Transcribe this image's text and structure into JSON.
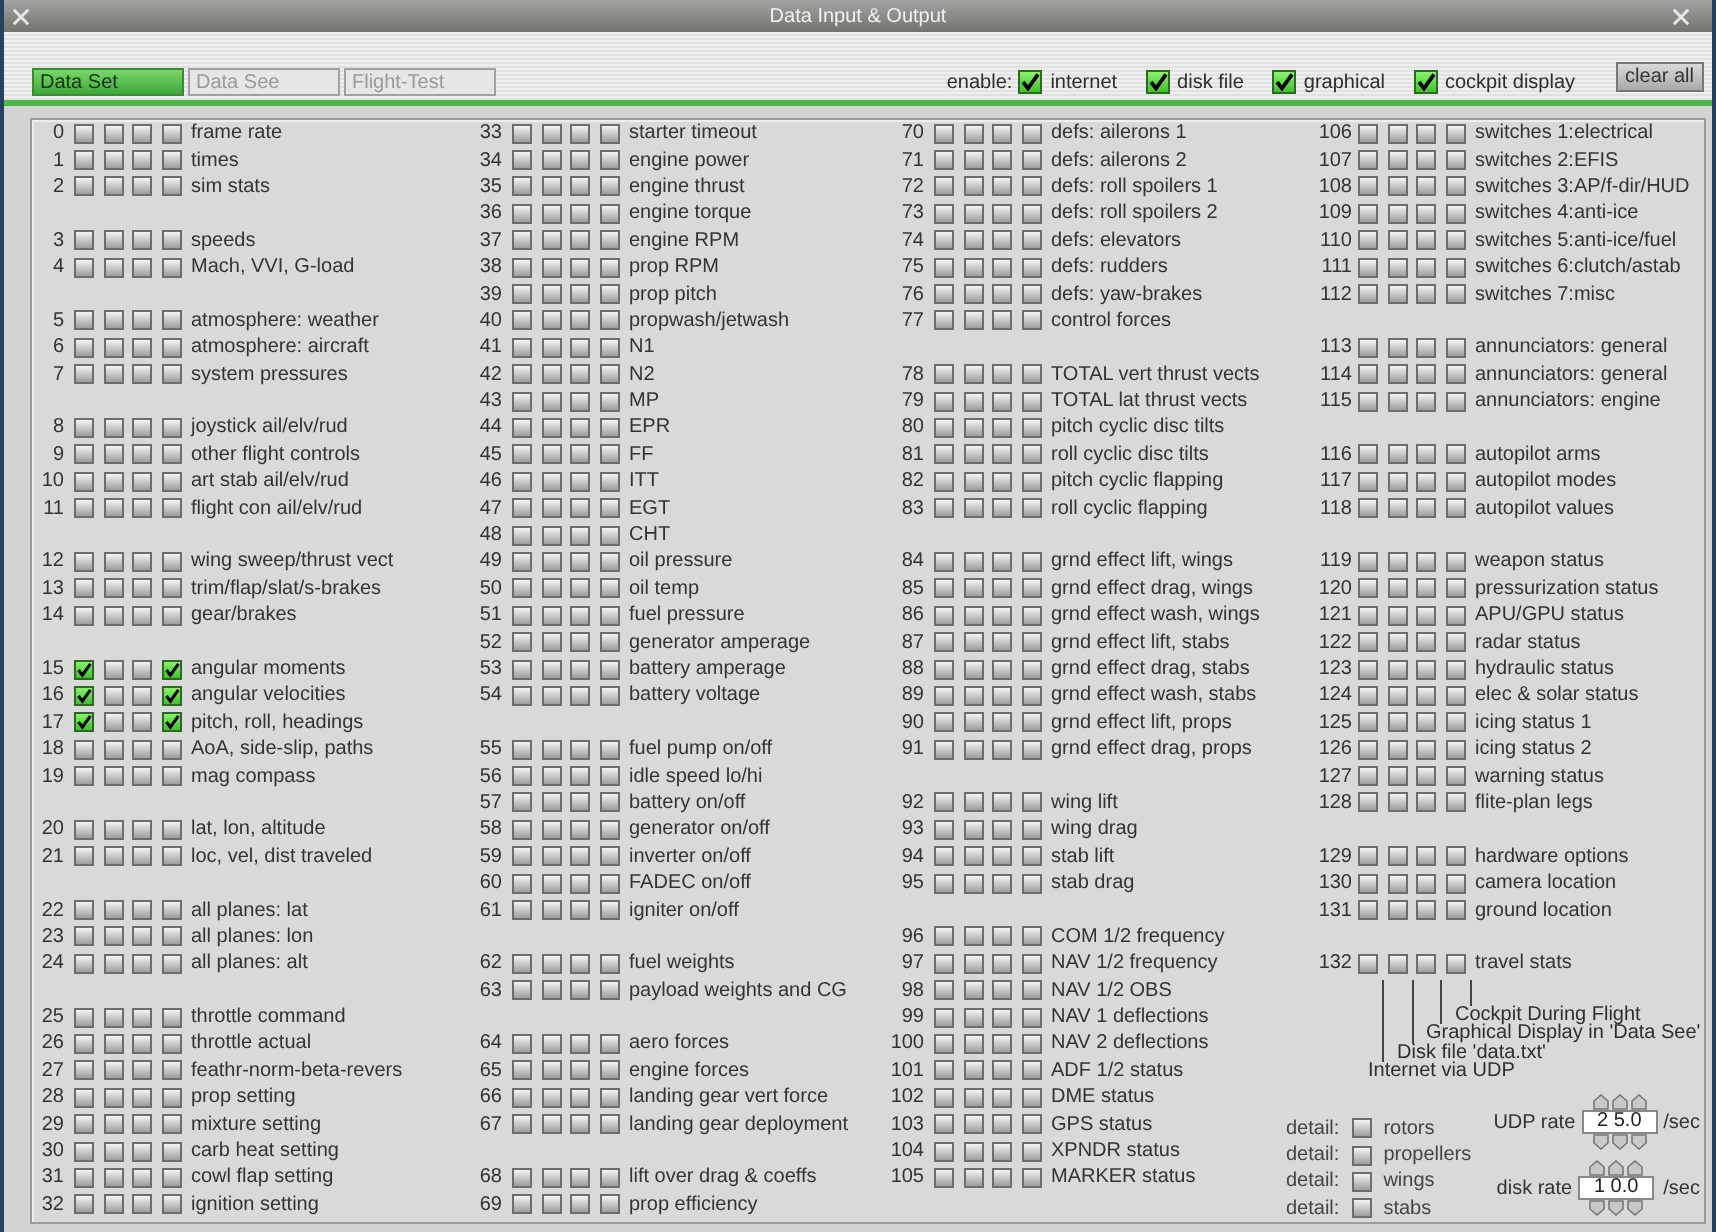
{
  "window": {
    "title": "Data Input & Output"
  },
  "tabs": [
    {
      "label": "Data Set",
      "selected": true
    },
    {
      "label": "Data See",
      "selected": false
    },
    {
      "label": "Flight-Test",
      "selected": false
    }
  ],
  "enable": {
    "label": "enable:",
    "options": [
      {
        "label": "internet",
        "checked": true
      },
      {
        "label": "disk file",
        "checked": true
      },
      {
        "label": "graphical",
        "checked": true
      },
      {
        "label": "cockpit display",
        "checked": true
      }
    ]
  },
  "clear_button": "clear all",
  "columns": [
    {
      "groups": [
        {
          "rows": [
            {
              "number": "0",
              "label": "frame rate",
              "checked": [
                false,
                false,
                false,
                false
              ]
            },
            {
              "number": "1",
              "label": "times",
              "checked": [
                false,
                false,
                false,
                false
              ]
            },
            {
              "number": "2",
              "label": "sim stats",
              "checked": [
                false,
                false,
                false,
                false
              ]
            }
          ]
        },
        {
          "rows": [
            {
              "number": "3",
              "label": "speeds",
              "checked": [
                false,
                false,
                false,
                false
              ]
            },
            {
              "number": "4",
              "label": "Mach, VVI, G-load",
              "checked": [
                false,
                false,
                false,
                false
              ]
            }
          ]
        },
        {
          "rows": [
            {
              "number": "5",
              "label": "atmosphere: weather",
              "checked": [
                false,
                false,
                false,
                false
              ]
            },
            {
              "number": "6",
              "label": "atmosphere: aircraft",
              "checked": [
                false,
                false,
                false,
                false
              ]
            },
            {
              "number": "7",
              "label": "system pressures",
              "checked": [
                false,
                false,
                false,
                false
              ]
            }
          ]
        },
        {
          "rows": [
            {
              "number": "8",
              "label": "joystick ail/elv/rud",
              "checked": [
                false,
                false,
                false,
                false
              ]
            },
            {
              "number": "9",
              "label": "other flight controls",
              "checked": [
                false,
                false,
                false,
                false
              ]
            },
            {
              "number": "10",
              "label": "art stab ail/elv/rud",
              "checked": [
                false,
                false,
                false,
                false
              ]
            },
            {
              "number": "11",
              "label": "flight con ail/elv/rud",
              "checked": [
                false,
                false,
                false,
                false
              ]
            }
          ]
        },
        {
          "rows": [
            {
              "number": "12",
              "label": "wing sweep/thrust vect",
              "checked": [
                false,
                false,
                false,
                false
              ]
            },
            {
              "number": "13",
              "label": "trim/flap/slat/s-brakes",
              "checked": [
                false,
                false,
                false,
                false
              ]
            },
            {
              "number": "14",
              "label": "gear/brakes",
              "checked": [
                false,
                false,
                false,
                false
              ]
            }
          ]
        },
        {
          "rows": [
            {
              "number": "15",
              "label": "angular moments",
              "checked": [
                true,
                false,
                false,
                true
              ]
            },
            {
              "number": "16",
              "label": "angular velocities",
              "checked": [
                true,
                false,
                false,
                true
              ]
            },
            {
              "number": "17",
              "label": "pitch, roll, headings",
              "checked": [
                true,
                false,
                false,
                true
              ]
            },
            {
              "number": "18",
              "label": "AoA, side-slip, paths",
              "checked": [
                false,
                false,
                false,
                false
              ]
            },
            {
              "number": "19",
              "label": "mag compass",
              "checked": [
                false,
                false,
                false,
                false
              ]
            }
          ]
        },
        {
          "rows": [
            {
              "number": "20",
              "label": "lat, lon, altitude",
              "checked": [
                false,
                false,
                false,
                false
              ]
            },
            {
              "number": "21",
              "label": "loc, vel, dist traveled",
              "checked": [
                false,
                false,
                false,
                false
              ]
            }
          ]
        },
        {
          "rows": [
            {
              "number": "22",
              "label": "all planes: lat",
              "checked": [
                false,
                false,
                false,
                false
              ]
            },
            {
              "number": "23",
              "label": "all planes: lon",
              "checked": [
                false,
                false,
                false,
                false
              ]
            },
            {
              "number": "24",
              "label": "all planes: alt",
              "checked": [
                false,
                false,
                false,
                false
              ]
            }
          ]
        },
        {
          "rows": [
            {
              "number": "25",
              "label": "throttle command",
              "checked": [
                false,
                false,
                false,
                false
              ]
            },
            {
              "number": "26",
              "label": "throttle actual",
              "checked": [
                false,
                false,
                false,
                false
              ]
            },
            {
              "number": "27",
              "label": "feathr-norm-beta-revers",
              "checked": [
                false,
                false,
                false,
                false
              ]
            },
            {
              "number": "28",
              "label": "prop setting",
              "checked": [
                false,
                false,
                false,
                false
              ]
            },
            {
              "number": "29",
              "label": "mixture setting",
              "checked": [
                false,
                false,
                false,
                false
              ]
            },
            {
              "number": "30",
              "label": "carb heat setting",
              "checked": [
                false,
                false,
                false,
                false
              ]
            },
            {
              "number": "31",
              "label": "cowl flap setting",
              "checked": [
                false,
                false,
                false,
                false
              ]
            },
            {
              "number": "32",
              "label": "ignition setting",
              "checked": [
                false,
                false,
                false,
                false
              ]
            }
          ]
        }
      ]
    },
    {
      "groups": [
        {
          "rows": [
            {
              "number": "33",
              "label": "starter timeout",
              "checked": [
                false,
                false,
                false,
                false
              ]
            },
            {
              "number": "34",
              "label": "engine power",
              "checked": [
                false,
                false,
                false,
                false
              ]
            },
            {
              "number": "35",
              "label": "engine thrust",
              "checked": [
                false,
                false,
                false,
                false
              ]
            },
            {
              "number": "36",
              "label": "engine torque",
              "checked": [
                false,
                false,
                false,
                false
              ]
            },
            {
              "number": "37",
              "label": "engine RPM",
              "checked": [
                false,
                false,
                false,
                false
              ]
            },
            {
              "number": "38",
              "label": "prop RPM",
              "checked": [
                false,
                false,
                false,
                false
              ]
            },
            {
              "number": "39",
              "label": "prop pitch",
              "checked": [
                false,
                false,
                false,
                false
              ]
            },
            {
              "number": "40",
              "label": "propwash/jetwash",
              "checked": [
                false,
                false,
                false,
                false
              ]
            },
            {
              "number": "41",
              "label": "N1",
              "checked": [
                false,
                false,
                false,
                false
              ]
            },
            {
              "number": "42",
              "label": "N2",
              "checked": [
                false,
                false,
                false,
                false
              ]
            },
            {
              "number": "43",
              "label": "MP",
              "checked": [
                false,
                false,
                false,
                false
              ]
            },
            {
              "number": "44",
              "label": "EPR",
              "checked": [
                false,
                false,
                false,
                false
              ]
            },
            {
              "number": "45",
              "label": "FF",
              "checked": [
                false,
                false,
                false,
                false
              ]
            },
            {
              "number": "46",
              "label": "ITT",
              "checked": [
                false,
                false,
                false,
                false
              ]
            },
            {
              "number": "47",
              "label": "EGT",
              "checked": [
                false,
                false,
                false,
                false
              ]
            },
            {
              "number": "48",
              "label": "CHT",
              "checked": [
                false,
                false,
                false,
                false
              ]
            },
            {
              "number": "49",
              "label": "oil pressure",
              "checked": [
                false,
                false,
                false,
                false
              ]
            },
            {
              "number": "50",
              "label": "oil temp",
              "checked": [
                false,
                false,
                false,
                false
              ]
            },
            {
              "number": "51",
              "label": "fuel pressure",
              "checked": [
                false,
                false,
                false,
                false
              ]
            },
            {
              "number": "52",
              "label": "generator amperage",
              "checked": [
                false,
                false,
                false,
                false
              ]
            },
            {
              "number": "53",
              "label": "battery amperage",
              "checked": [
                false,
                false,
                false,
                false
              ]
            },
            {
              "number": "54",
              "label": "battery voltage",
              "checked": [
                false,
                false,
                false,
                false
              ]
            }
          ]
        },
        {
          "rows": [
            {
              "number": "55",
              "label": "fuel pump on/off",
              "checked": [
                false,
                false,
                false,
                false
              ]
            },
            {
              "number": "56",
              "label": "idle speed lo/hi",
              "checked": [
                false,
                false,
                false,
                false
              ]
            },
            {
              "number": "57",
              "label": "battery on/off",
              "checked": [
                false,
                false,
                false,
                false
              ]
            },
            {
              "number": "58",
              "label": "generator on/off",
              "checked": [
                false,
                false,
                false,
                false
              ]
            },
            {
              "number": "59",
              "label": "inverter on/off",
              "checked": [
                false,
                false,
                false,
                false
              ]
            },
            {
              "number": "60",
              "label": "FADEC on/off",
              "checked": [
                false,
                false,
                false,
                false
              ]
            },
            {
              "number": "61",
              "label": "igniter on/off",
              "checked": [
                false,
                false,
                false,
                false
              ]
            }
          ]
        },
        {
          "rows": [
            {
              "number": "62",
              "label": "fuel weights",
              "checked": [
                false,
                false,
                false,
                false
              ]
            },
            {
              "number": "63",
              "label": "payload weights and CG",
              "checked": [
                false,
                false,
                false,
                false
              ]
            }
          ]
        },
        {
          "rows": [
            {
              "number": "64",
              "label": "aero forces",
              "checked": [
                false,
                false,
                false,
                false
              ]
            },
            {
              "number": "65",
              "label": "engine forces",
              "checked": [
                false,
                false,
                false,
                false
              ]
            },
            {
              "number": "66",
              "label": "landing gear vert force",
              "checked": [
                false,
                false,
                false,
                false
              ]
            },
            {
              "number": "67",
              "label": "landing gear deployment",
              "checked": [
                false,
                false,
                false,
                false
              ]
            }
          ]
        },
        {
          "rows": [
            {
              "number": "68",
              "label": "lift over drag & coeffs",
              "checked": [
                false,
                false,
                false,
                false
              ]
            },
            {
              "number": "69",
              "label": "prop efficiency",
              "checked": [
                false,
                false,
                false,
                false
              ]
            }
          ]
        }
      ]
    },
    {
      "groups": [
        {
          "rows": [
            {
              "number": "70",
              "label": "defs: ailerons 1",
              "checked": [
                false,
                false,
                false,
                false
              ]
            },
            {
              "number": "71",
              "label": "defs: ailerons 2",
              "checked": [
                false,
                false,
                false,
                false
              ]
            },
            {
              "number": "72",
              "label": "defs: roll spoilers 1",
              "checked": [
                false,
                false,
                false,
                false
              ]
            },
            {
              "number": "73",
              "label": "defs: roll spoilers 2",
              "checked": [
                false,
                false,
                false,
                false
              ]
            },
            {
              "number": "74",
              "label": "defs: elevators",
              "checked": [
                false,
                false,
                false,
                false
              ]
            },
            {
              "number": "75",
              "label": "defs: rudders",
              "checked": [
                false,
                false,
                false,
                false
              ]
            },
            {
              "number": "76",
              "label": "defs: yaw-brakes",
              "checked": [
                false,
                false,
                false,
                false
              ]
            },
            {
              "number": "77",
              "label": "control forces",
              "checked": [
                false,
                false,
                false,
                false
              ]
            }
          ]
        },
        {
          "rows": [
            {
              "number": "78",
              "label": "TOTAL vert thrust vects",
              "checked": [
                false,
                false,
                false,
                false
              ]
            },
            {
              "number": "79",
              "label": "TOTAL lat  thrust vects",
              "checked": [
                false,
                false,
                false,
                false
              ]
            },
            {
              "number": "80",
              "label": "pitch cyclic disc tilts",
              "checked": [
                false,
                false,
                false,
                false
              ]
            },
            {
              "number": "81",
              "label": "roll cyclic disc tilts",
              "checked": [
                false,
                false,
                false,
                false
              ]
            },
            {
              "number": "82",
              "label": "pitch cyclic flapping",
              "checked": [
                false,
                false,
                false,
                false
              ]
            },
            {
              "number": "83",
              "label": "roll cyclic flapping",
              "checked": [
                false,
                false,
                false,
                false
              ]
            }
          ]
        },
        {
          "rows": [
            {
              "number": "84",
              "label": "grnd effect lift, wings",
              "checked": [
                false,
                false,
                false,
                false
              ]
            },
            {
              "number": "85",
              "label": "grnd effect drag, wings",
              "checked": [
                false,
                false,
                false,
                false
              ]
            },
            {
              "number": "86",
              "label": "grnd effect wash, wings",
              "checked": [
                false,
                false,
                false,
                false
              ]
            },
            {
              "number": "87",
              "label": "grnd effect lift, stabs",
              "checked": [
                false,
                false,
                false,
                false
              ]
            },
            {
              "number": "88",
              "label": "grnd effect drag, stabs",
              "checked": [
                false,
                false,
                false,
                false
              ]
            },
            {
              "number": "89",
              "label": "grnd effect wash, stabs",
              "checked": [
                false,
                false,
                false,
                false
              ]
            },
            {
              "number": "90",
              "label": "grnd effect lift, props",
              "checked": [
                false,
                false,
                false,
                false
              ]
            },
            {
              "number": "91",
              "label": "grnd effect drag, props",
              "checked": [
                false,
                false,
                false,
                false
              ]
            }
          ]
        },
        {
          "rows": [
            {
              "number": "92",
              "label": "wing lift",
              "checked": [
                false,
                false,
                false,
                false
              ]
            },
            {
              "number": "93",
              "label": "wing drag",
              "checked": [
                false,
                false,
                false,
                false
              ]
            },
            {
              "number": "94",
              "label": "stab lift",
              "checked": [
                false,
                false,
                false,
                false
              ]
            },
            {
              "number": "95",
              "label": "stab drag",
              "checked": [
                false,
                false,
                false,
                false
              ]
            }
          ]
        },
        {
          "rows": [
            {
              "number": "96",
              "label": "COM 1/2 frequency",
              "checked": [
                false,
                false,
                false,
                false
              ]
            },
            {
              "number": "97",
              "label": "NAV 1/2 frequency",
              "checked": [
                false,
                false,
                false,
                false
              ]
            },
            {
              "number": "98",
              "label": "NAV 1/2 OBS",
              "checked": [
                false,
                false,
                false,
                false
              ]
            },
            {
              "number": "99",
              "label": "NAV 1 deflections",
              "checked": [
                false,
                false,
                false,
                false
              ]
            },
            {
              "number": "100",
              "label": "NAV 2 deflections",
              "checked": [
                false,
                false,
                false,
                false
              ]
            },
            {
              "number": "101",
              "label": "ADF 1/2 status",
              "checked": [
                false,
                false,
                false,
                false
              ]
            },
            {
              "number": "102",
              "label": "DME status",
              "checked": [
                false,
                false,
                false,
                false
              ]
            },
            {
              "number": "103",
              "label": "GPS status",
              "checked": [
                false,
                false,
                false,
                false
              ]
            },
            {
              "number": "104",
              "label": "XPNDR status",
              "checked": [
                false,
                false,
                false,
                false
              ]
            },
            {
              "number": "105",
              "label": "MARKER status",
              "checked": [
                false,
                false,
                false,
                false
              ]
            }
          ]
        }
      ]
    },
    {
      "groups": [
        {
          "rows": [
            {
              "number": "106",
              "label": "switches 1:electrical",
              "checked": [
                false,
                false,
                false,
                false
              ]
            },
            {
              "number": "107",
              "label": "switches 2:EFIS",
              "checked": [
                false,
                false,
                false,
                false
              ]
            },
            {
              "number": "108",
              "label": "switches 3:AP/f-dir/HUD",
              "checked": [
                false,
                false,
                false,
                false
              ]
            },
            {
              "number": "109",
              "label": "switches 4:anti-ice",
              "checked": [
                false,
                false,
                false,
                false
              ]
            },
            {
              "number": "110",
              "label": "switches 5:anti-ice/fuel",
              "checked": [
                false,
                false,
                false,
                false
              ]
            },
            {
              "number": "111",
              "label": "switches 6:clutch/astab",
              "checked": [
                false,
                false,
                false,
                false
              ]
            },
            {
              "number": "112",
              "label": "switches 7:misc",
              "checked": [
                false,
                false,
                false,
                false
              ]
            }
          ]
        },
        {
          "rows": [
            {
              "number": "113",
              "label": "annunciators: general",
              "checked": [
                false,
                false,
                false,
                false
              ]
            },
            {
              "number": "114",
              "label": "annunciators: general",
              "checked": [
                false,
                false,
                false,
                false
              ]
            },
            {
              "number": "115",
              "label": "annunciators: engine",
              "checked": [
                false,
                false,
                false,
                false
              ]
            }
          ]
        },
        {
          "rows": [
            {
              "number": "116",
              "label": "autopilot arms",
              "checked": [
                false,
                false,
                false,
                false
              ]
            },
            {
              "number": "117",
              "label": "autopilot modes",
              "checked": [
                false,
                false,
                false,
                false
              ]
            },
            {
              "number": "118",
              "label": "autopilot values",
              "checked": [
                false,
                false,
                false,
                false
              ]
            }
          ]
        },
        {
          "rows": [
            {
              "number": "119",
              "label": "weapon status",
              "checked": [
                false,
                false,
                false,
                false
              ]
            },
            {
              "number": "120",
              "label": "pressurization status",
              "checked": [
                false,
                false,
                false,
                false
              ]
            },
            {
              "number": "121",
              "label": "APU/GPU status",
              "checked": [
                false,
                false,
                false,
                false
              ]
            },
            {
              "number": "122",
              "label": "radar status",
              "checked": [
                false,
                false,
                false,
                false
              ]
            },
            {
              "number": "123",
              "label": "hydraulic status",
              "checked": [
                false,
                false,
                false,
                false
              ]
            },
            {
              "number": "124",
              "label": "elec & solar status",
              "checked": [
                false,
                false,
                false,
                false
              ]
            },
            {
              "number": "125",
              "label": "icing status 1",
              "checked": [
                false,
                false,
                false,
                false
              ]
            },
            {
              "number": "126",
              "label": "icing status 2",
              "checked": [
                false,
                false,
                false,
                false
              ]
            },
            {
              "number": "127",
              "label": "warning status",
              "checked": [
                false,
                false,
                false,
                false
              ]
            },
            {
              "number": "128",
              "label": "flite-plan legs",
              "checked": [
                false,
                false,
                false,
                false
              ]
            }
          ]
        },
        {
          "rows": [
            {
              "number": "129",
              "label": "hardware options",
              "checked": [
                false,
                false,
                false,
                false
              ]
            },
            {
              "number": "130",
              "label": "camera location",
              "checked": [
                false,
                false,
                false,
                false
              ]
            },
            {
              "number": "131",
              "label": "ground location",
              "checked": [
                false,
                false,
                false,
                false
              ]
            }
          ]
        },
        {
          "rows": [
            {
              "number": "132",
              "label": "travel stats",
              "checked": [
                false,
                false,
                false,
                false
              ]
            }
          ]
        }
      ]
    }
  ],
  "output_legend": [
    "Cockpit During Flight",
    "Graphical Display in 'Data See'",
    "Disk file 'data.txt'",
    "Internet via UDP"
  ],
  "details": [
    {
      "prefix": "detail:",
      "label": "rotors",
      "checked": false
    },
    {
      "prefix": "detail:",
      "label": "propellers",
      "checked": false
    },
    {
      "prefix": "detail:",
      "label": "wings",
      "checked": false
    },
    {
      "prefix": "detail:",
      "label": "stabs",
      "checked": false
    }
  ],
  "rates": [
    {
      "label": "UDP rate",
      "value": "2 5.0",
      "unit": "/sec"
    },
    {
      "label": "disk rate",
      "value": "1 0.0",
      "unit": "/sec"
    }
  ]
}
